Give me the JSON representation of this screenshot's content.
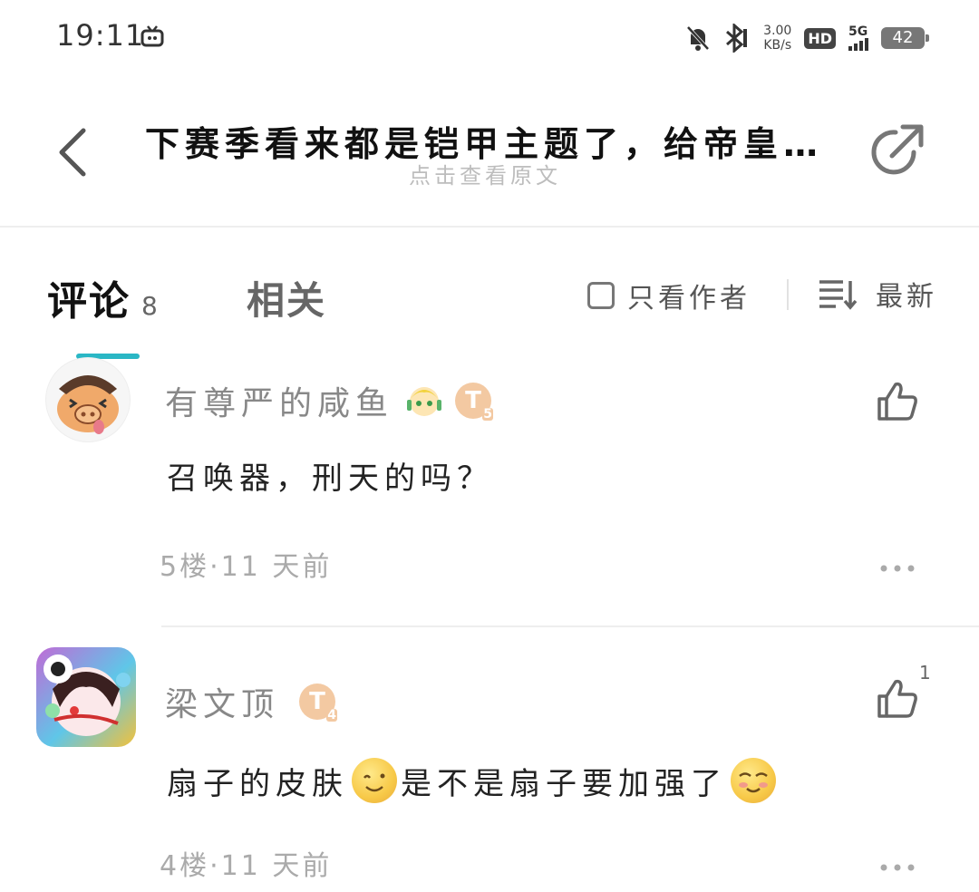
{
  "status_bar": {
    "time": "19:11",
    "net_speed_value": "3.00",
    "net_speed_unit": "KB/s",
    "hd": "HD",
    "network": "5G",
    "battery": "42"
  },
  "header": {
    "title": "下赛季看来都是铠甲主题了，给帝皇侠...",
    "subtitle": "点击查看原文"
  },
  "tabs": {
    "comments_label": "评论",
    "comments_count": "8",
    "related_label": "相关",
    "author_only": "只看作者",
    "sort": "最新"
  },
  "comments": [
    {
      "username": "有尊严的咸鱼",
      "level": "T",
      "level_num": "5",
      "text": "召唤器，刑天的吗？",
      "floor_time": "5楼·11 天前",
      "likes": ""
    },
    {
      "username": "梁文顶",
      "level": "T",
      "level_num": "4",
      "text_a": "扇子的皮肤",
      "text_b": "是不是扇子要加强了",
      "floor_time": "4楼·11 天前",
      "likes": "1"
    }
  ],
  "colors": {
    "accent": "#2ab7c5",
    "badge": "#f3c9a2",
    "muted": "#aaaaaa"
  },
  "icons": [
    "tv-icon",
    "mute-icon",
    "bluetooth-icon",
    "back-icon",
    "share-icon",
    "sort-icon",
    "like-icon",
    "more-icon"
  ]
}
